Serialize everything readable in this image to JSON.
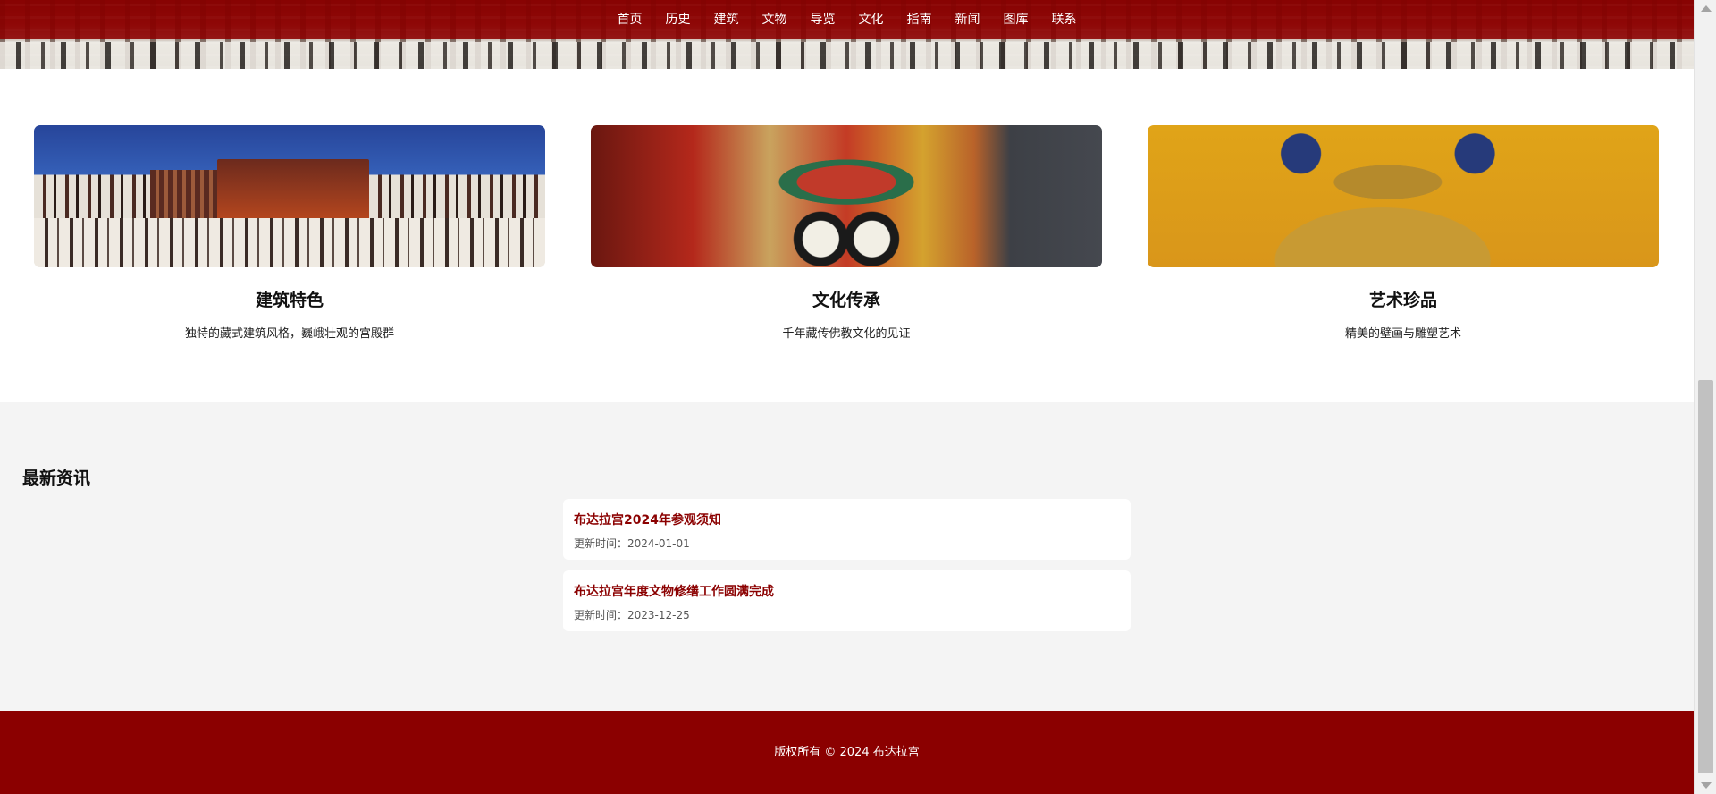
{
  "nav": {
    "items": [
      "首页",
      "历史",
      "建筑",
      "文物",
      "导览",
      "文化",
      "指南",
      "新闻",
      "图库",
      "联系"
    ]
  },
  "features": [
    {
      "title": "建筑特色",
      "desc": "独特的藏式建筑风格，巍峨壮观的宫殿群"
    },
    {
      "title": "文化传承",
      "desc": "千年藏传佛教文化的见证"
    },
    {
      "title": "艺术珍品",
      "desc": "精美的壁画与雕塑艺术"
    }
  ],
  "news": {
    "heading": "最新资讯",
    "items": [
      {
        "title": "布达拉宫2024年参观须知",
        "date": "更新时间：2024-01-01"
      },
      {
        "title": "布达拉宫年度文物修缮工作圆满完成",
        "date": "更新时间：2023-12-25"
      }
    ]
  },
  "footer": {
    "text": "版权所有 © 2024 布达拉宫"
  },
  "colors": {
    "brand": "#8b0000",
    "section_bg": "#f4f4f4"
  }
}
